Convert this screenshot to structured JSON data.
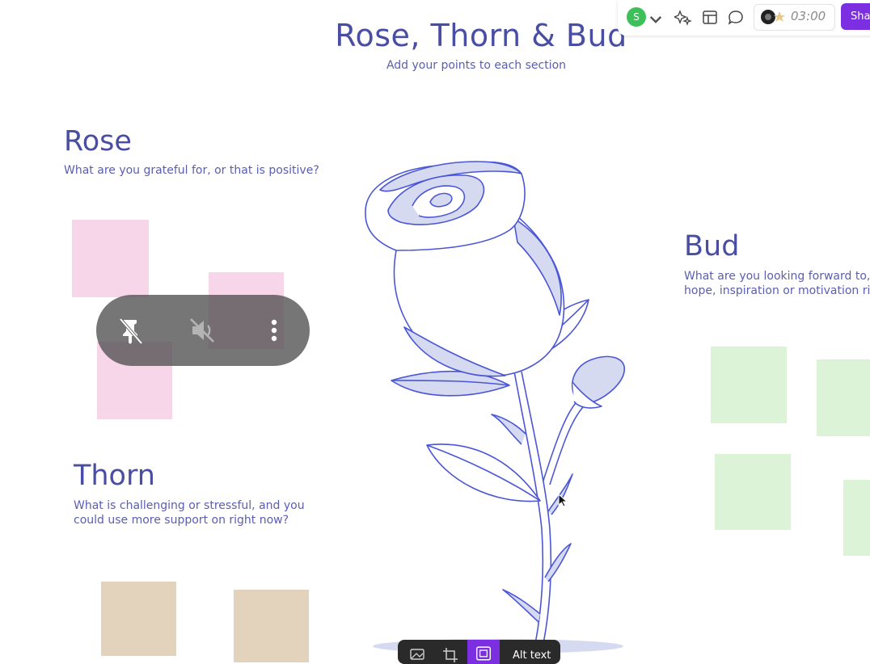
{
  "board": {
    "title": "Rose, Thorn & Bud",
    "subtitle": "Add your points to each section"
  },
  "sections": {
    "rose": {
      "title": "Rose",
      "description": "What are you grateful for, or that is positive?"
    },
    "thorn": {
      "title": "Thorn",
      "description_line1": "What is challenging or stressful, and you",
      "description_line2": "could use more support on right now?"
    },
    "bud": {
      "title": "Bud",
      "description_line1": "What are you looking forward to, o",
      "description_line2": "hope, inspiration or motivation righ"
    }
  },
  "toolbar": {
    "avatar_initial": "S",
    "timer": "03:00",
    "share_label": "Shar"
  },
  "image_toolbar": {
    "alt_text_label": "Alt text"
  },
  "colors": {
    "accent_purple": "#7b2fe0",
    "heading_blue": "#4a4ea3",
    "rose_note": "#f8d6ea",
    "bud_note": "#dcf3d7",
    "thorn_note": "#e3d2bc",
    "avatar_green": "#3dbf5a"
  },
  "icons": {
    "avatar_chevron": "chevron-down-icon",
    "ai_sparkle": "sparkle-icon",
    "layout": "layout-icon",
    "comment": "comment-icon",
    "unpin": "unpin-icon",
    "mute": "mute-icon",
    "more": "more-vertical-icon",
    "image": "image-icon",
    "crop": "crop-icon",
    "frame": "frame-icon"
  }
}
